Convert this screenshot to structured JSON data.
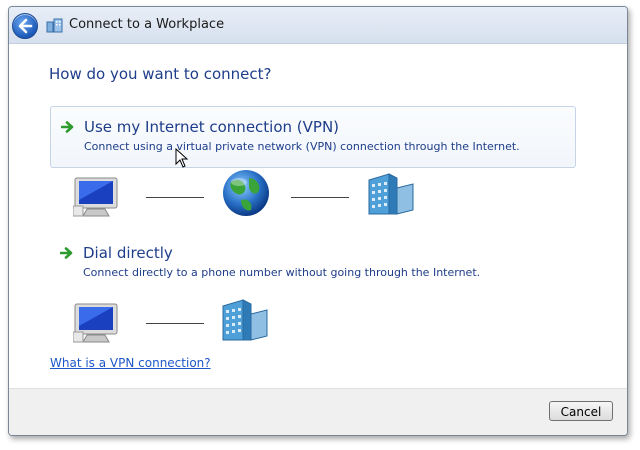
{
  "window": {
    "title": "Connect to a Workplace"
  },
  "heading": "How do you want to connect?",
  "options": [
    {
      "title": "Use my Internet connection (VPN)",
      "description": "Connect using a virtual private network (VPN) connection through the Internet."
    },
    {
      "title": "Dial directly",
      "description": "Connect directly to a phone number without going through the Internet."
    }
  ],
  "help_link": "What is a VPN connection?",
  "footer": {
    "cancel_label": "Cancel"
  },
  "icons": {
    "back": "back-arrow-icon",
    "title": "workplace-network-icon",
    "option_arrow": "green-arrow-icon",
    "computer": "computer-icon",
    "internet": "globe-icon",
    "workplace": "office-building-icon"
  },
  "colors": {
    "link_blue": "#1e3d8a",
    "hyperlink": "#1e58c8",
    "arrow_green": "#2e9b2e"
  }
}
